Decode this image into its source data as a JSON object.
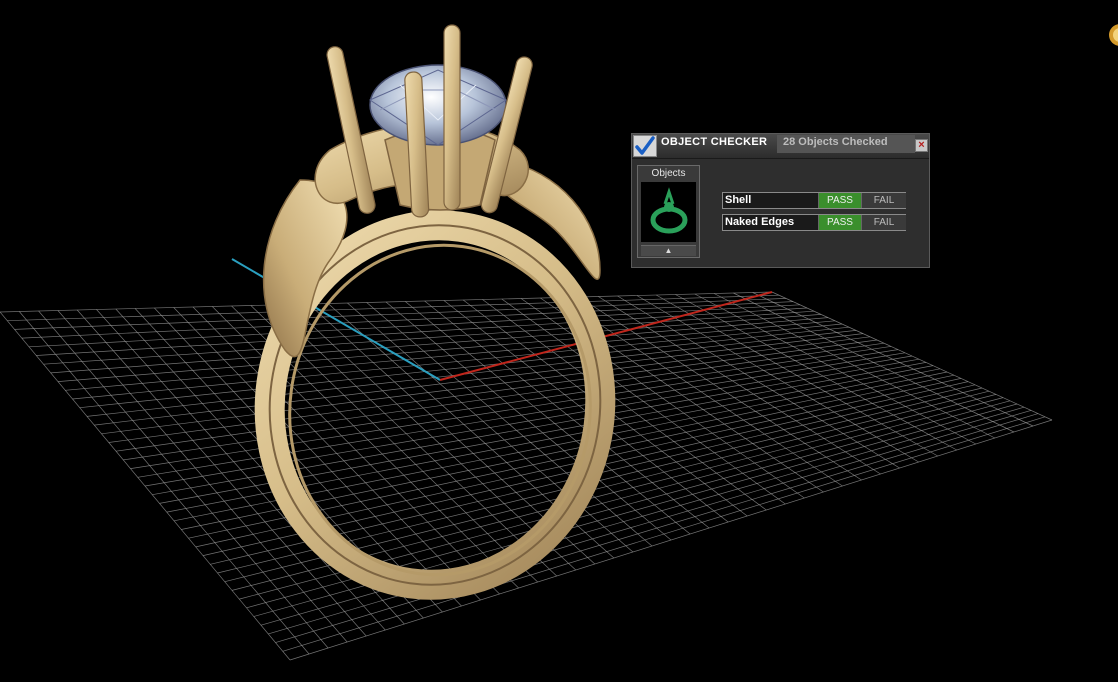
{
  "object_checker": {
    "title": "OBJECT CHECKER",
    "status": "28 Objects Checked",
    "objects_label": "Objects",
    "rows": [
      {
        "label": "Shell",
        "pass": "PASS",
        "fail": "FAIL",
        "result": "pass"
      },
      {
        "label": "Naked Edges",
        "pass": "PASS",
        "fail": "FAIL",
        "result": "pass"
      }
    ]
  },
  "viewport": {
    "scene": "ring-model",
    "colors": {
      "background": "#000000",
      "grid": "#9a9a9a",
      "x_axis": "#c0261c",
      "y_axis": "#2a9fbf",
      "metal": "#d8c18f",
      "pass_green": "#3a8f2c"
    }
  }
}
